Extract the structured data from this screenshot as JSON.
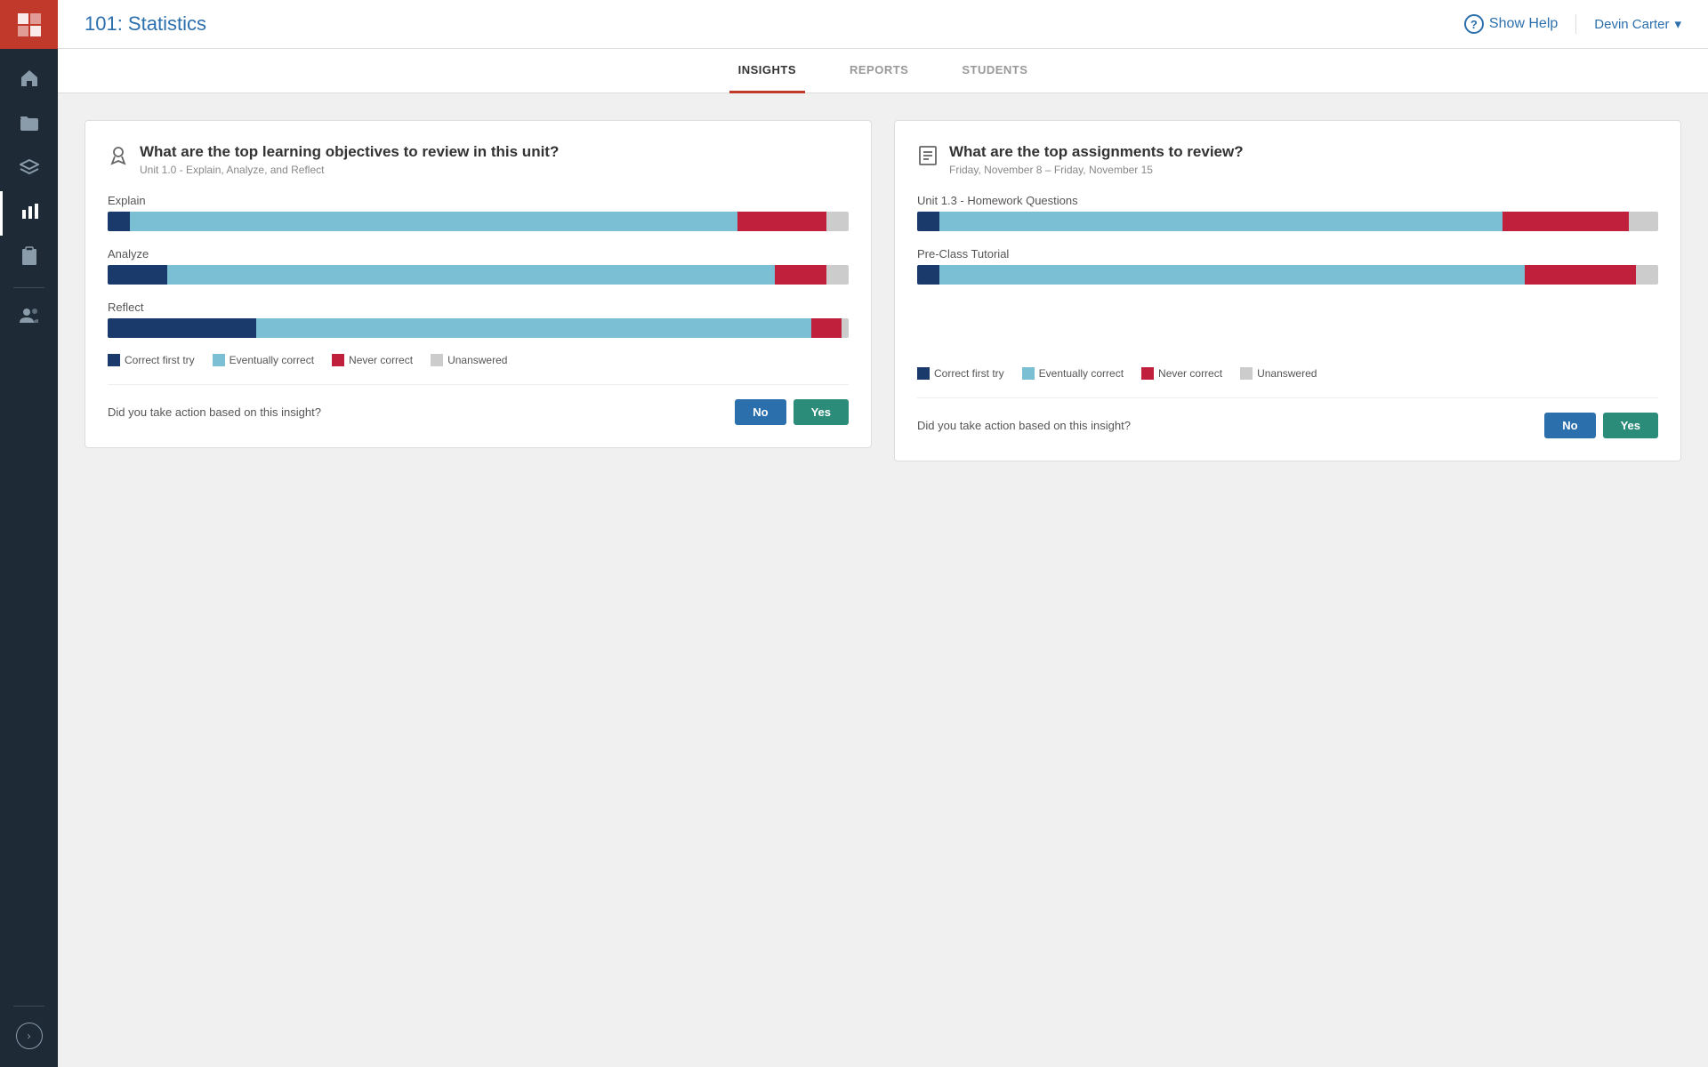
{
  "sidebar": {
    "logo": "M",
    "items": [
      {
        "id": "home",
        "icon": "⌂",
        "active": false
      },
      {
        "id": "folder",
        "icon": "▣",
        "active": false
      },
      {
        "id": "layers",
        "icon": "◫",
        "active": false
      },
      {
        "id": "chart",
        "icon": "▦",
        "active": true
      },
      {
        "id": "clipboard",
        "icon": "◧",
        "active": false
      },
      {
        "id": "users",
        "icon": "👥",
        "active": false
      }
    ],
    "expand_icon": "›"
  },
  "header": {
    "title": "101: Statistics",
    "show_help_label": "Show Help",
    "user_name": "Devin Carter",
    "help_icon": "?"
  },
  "tabs": [
    {
      "id": "insights",
      "label": "INSIGHTS",
      "active": true
    },
    {
      "id": "reports",
      "label": "REPORTS",
      "active": false
    },
    {
      "id": "students",
      "label": "STUDENTS",
      "active": false
    }
  ],
  "card_left": {
    "title": "What are the top learning objectives to review in this unit?",
    "subtitle": "Unit 1.0 - Explain, Analyze, and Reflect",
    "bars": [
      {
        "label": "Explain",
        "segments": [
          {
            "type": "correct_first",
            "pct": 3
          },
          {
            "type": "eventually",
            "pct": 82
          },
          {
            "type": "never",
            "pct": 12
          },
          {
            "type": "unanswered",
            "pct": 3
          }
        ]
      },
      {
        "label": "Analyze",
        "segments": [
          {
            "type": "correct_first",
            "pct": 8
          },
          {
            "type": "eventually",
            "pct": 82
          },
          {
            "type": "never",
            "pct": 7
          },
          {
            "type": "unanswered",
            "pct": 3
          }
        ]
      },
      {
        "label": "Reflect",
        "segments": [
          {
            "type": "correct_first",
            "pct": 20
          },
          {
            "type": "eventually",
            "pct": 75
          },
          {
            "type": "never",
            "pct": 4
          },
          {
            "type": "unanswered",
            "pct": 1
          }
        ]
      }
    ],
    "legend": [
      {
        "id": "correct_first",
        "label": "Correct first try"
      },
      {
        "id": "eventually",
        "label": "Eventually correct"
      },
      {
        "id": "never",
        "label": "Never correct"
      },
      {
        "id": "unanswered",
        "label": "Unanswered"
      }
    ],
    "action_question": "Did you take action based on this insight?",
    "btn_no": "No",
    "btn_yes": "Yes"
  },
  "card_right": {
    "title": "What are the top assignments to review?",
    "subtitle": "Friday, November 8 – Friday, November 15",
    "bars": [
      {
        "label": "Unit 1.3 - Homework Questions",
        "segments": [
          {
            "type": "correct_first",
            "pct": 3
          },
          {
            "type": "eventually",
            "pct": 76
          },
          {
            "type": "never",
            "pct": 17
          },
          {
            "type": "unanswered",
            "pct": 4
          }
        ]
      },
      {
        "label": "Pre-Class Tutorial",
        "segments": [
          {
            "type": "correct_first",
            "pct": 3
          },
          {
            "type": "eventually",
            "pct": 79
          },
          {
            "type": "never",
            "pct": 15
          },
          {
            "type": "unanswered",
            "pct": 3
          }
        ]
      }
    ],
    "legend": [
      {
        "id": "correct_first",
        "label": "Correct first try"
      },
      {
        "id": "eventually",
        "label": "Eventually correct"
      },
      {
        "id": "never",
        "label": "Never correct"
      },
      {
        "id": "unanswered",
        "label": "Unanswered"
      }
    ],
    "action_question": "Did you take action based on this insight?",
    "btn_no": "No",
    "btn_yes": "Yes"
  },
  "colors": {
    "correct_first": "#1a3a6b",
    "eventually": "#7bbfd4",
    "never": "#c0203c",
    "unanswered": "#cccccc"
  }
}
